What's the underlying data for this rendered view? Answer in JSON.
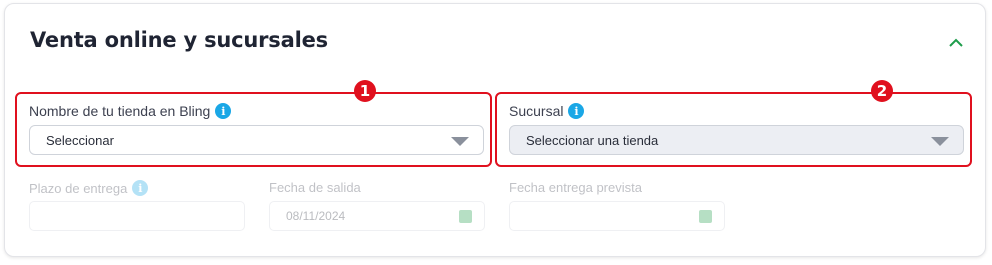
{
  "section": {
    "title": "Venta online y sucursales",
    "collapse_icon": "chevron-up-icon"
  },
  "store_field": {
    "label": "Nombre de tu tienda en Bling",
    "info_icon": "info-icon",
    "value": "Seleccionar",
    "badge": "1"
  },
  "branch_field": {
    "label": "Sucursal",
    "info_icon": "info-icon",
    "value": "Seleccionar una tienda",
    "badge": "2"
  },
  "delivery_term": {
    "label": "Plazo de entrega",
    "value": ""
  },
  "ship_date": {
    "label": "Fecha de salida",
    "value": "08/11/2024"
  },
  "expected_date": {
    "label": "Fecha entrega prevista",
    "value": ""
  },
  "colors": {
    "highlight": "#e0101e",
    "info": "#1aa7e6",
    "chevron": "#1e9d4b"
  }
}
